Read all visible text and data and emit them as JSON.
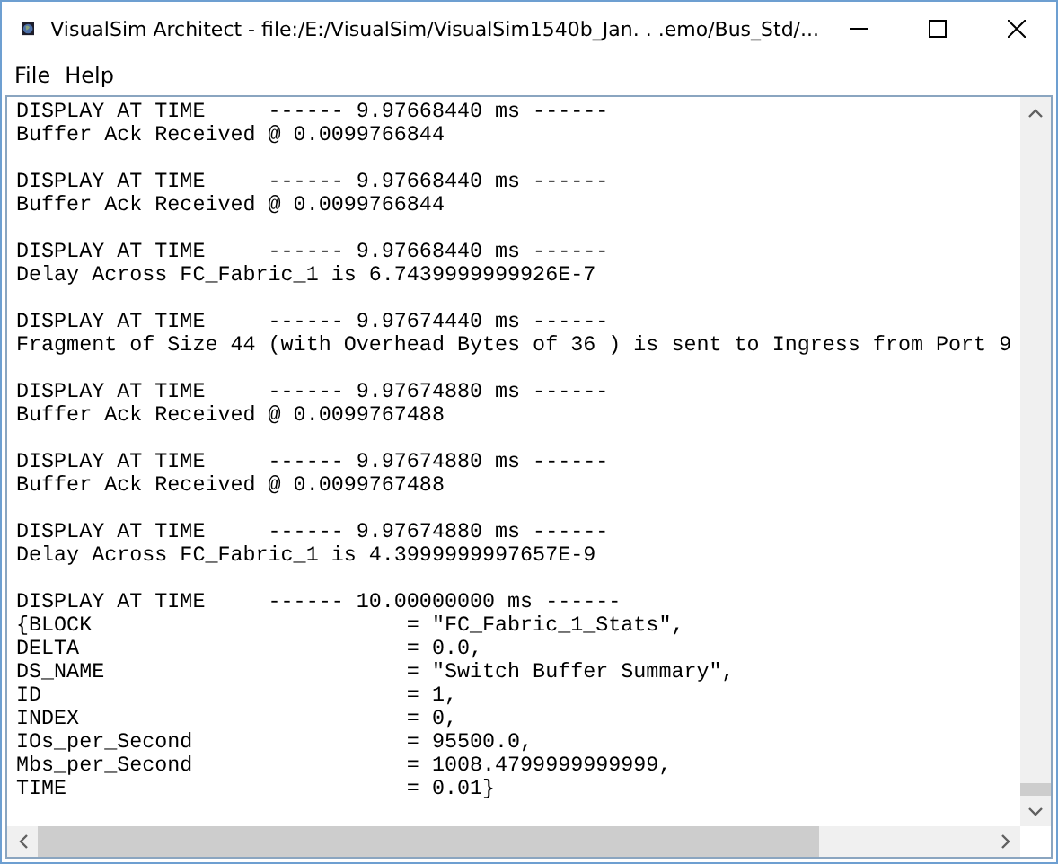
{
  "window": {
    "title": "VisualSim Architect - file:/E:/VisualSim/VisualSim1540b_Jan. . .emo/Bus_Std/..."
  },
  "menu": [
    {
      "label": "File"
    },
    {
      "label": "Help"
    }
  ],
  "log": {
    "entries": [
      {
        "lines": [
          "DISPLAY AT TIME     ------ 9.97668440 ms ------",
          "Buffer Ack Received @ 0.0099766844"
        ]
      },
      {
        "lines": [
          "DISPLAY AT TIME     ------ 9.97668440 ms ------",
          "Buffer Ack Received @ 0.0099766844"
        ]
      },
      {
        "lines": [
          "DISPLAY AT TIME     ------ 9.97668440 ms ------",
          "Delay Across FC_Fabric_1 is 6.7439999999926E-7"
        ]
      },
      {
        "lines": [
          "DISPLAY AT TIME     ------ 9.97674440 ms ------",
          "Fragment of Size 44 (with Overhead Bytes of 36 ) is sent to Ingress from Port 9"
        ]
      },
      {
        "lines": [
          "DISPLAY AT TIME     ------ 9.97674880 ms ------",
          "Buffer Ack Received @ 0.0099767488"
        ]
      },
      {
        "lines": [
          "DISPLAY AT TIME     ------ 9.97674880 ms ------",
          "Buffer Ack Received @ 0.0099767488"
        ]
      },
      {
        "lines": [
          "DISPLAY AT TIME     ------ 9.97674880 ms ------",
          "Delay Across FC_Fabric_1 is 4.3999999997657E-9"
        ]
      },
      {
        "lines": [
          "DISPLAY AT TIME     ------ 10.00000000 ms ------",
          "{BLOCK                         = \"FC_Fabric_1_Stats\",",
          "DELTA                          = 0.0,",
          "DS_NAME                        = \"Switch Buffer Summary\",",
          "ID                             = 1,",
          "INDEX                          = 0,",
          "IOs_per_Second                 = 95500.0,",
          "Mbs_per_Second                 = 1008.4799999999999,",
          "TIME                           = 0.01}"
        ]
      }
    ]
  }
}
